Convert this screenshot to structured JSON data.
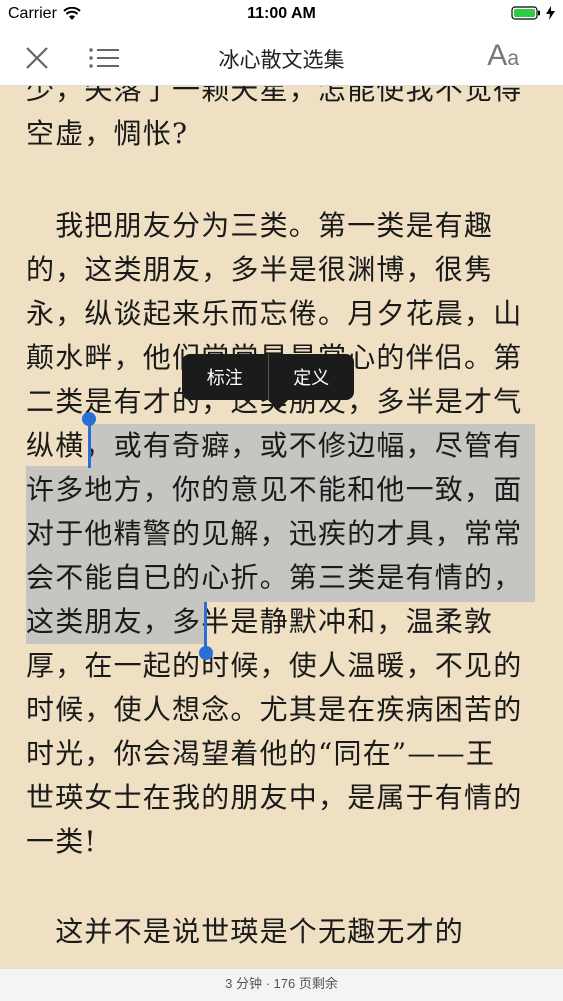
{
  "status": {
    "carrier": "Carrier",
    "time": "11:00 AM"
  },
  "nav": {
    "title": "冰心散文选集",
    "font_big": "A",
    "font_small": "a"
  },
  "text_lines": [
    "少，失落了一颗天星，怎能使我不觉得",
    "空虚，惆怅?",
    "",
    "　我把朋友分为三类。第一类是有趣",
    "的，这类朋友，多半是很渊博，很隽",
    "永，纵谈起来乐而忘倦。月夕花晨，山",
    "颠水畔，他们常常是最赏心的伴侣。第",
    "二类是有才的，这类朋友，多半是才气",
    "纵横，或有奇癖，或不修边幅，尽管有",
    "许多地方，你的意见不能和他一致，面",
    "对于他精警的见解，迅疾的才具，常常",
    "会不能自已的心折。第三类是有情的，",
    "这类朋友，多半是静默冲和，温柔敦",
    "厚，在一起的时候，使人温暖，不见的",
    "时候，使人想念。尤其是在疾病困苦的",
    "时光，你会渴望着他的“同在”——王",
    "世瑛女士在我的朋友中，是属于有情的",
    "一类!",
    "",
    "　这并不是说世瑛是个无趣无才的"
  ],
  "menu": {
    "annotate": "标注",
    "define": "定义"
  },
  "footer": {
    "remaining": "3 分钟 · 176  页剩余"
  },
  "colors": {
    "page_bg": "#efe0c4",
    "selection": "#b8bcc0",
    "handle": "#2a6fd6"
  }
}
